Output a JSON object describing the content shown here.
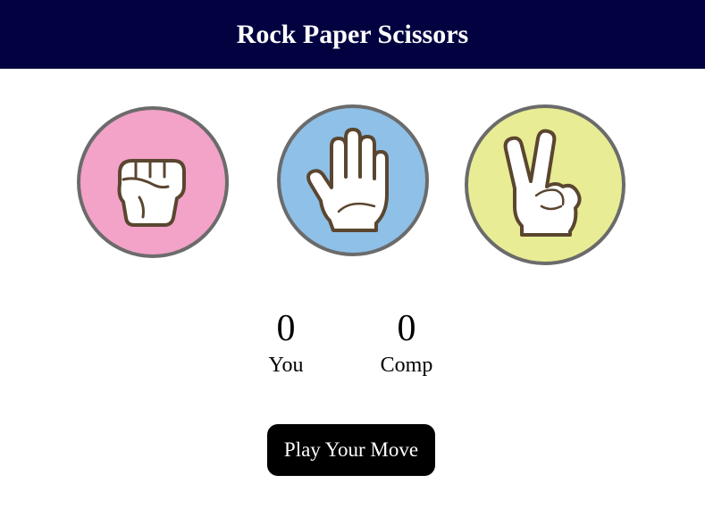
{
  "header": {
    "title": "Rock Paper Scissors"
  },
  "choices": [
    {
      "id": "rock",
      "icon": "fist-icon",
      "color": "#f3a2c8"
    },
    {
      "id": "paper",
      "icon": "open-hand-icon",
      "color": "#8ec0e8"
    },
    {
      "id": "scissors",
      "icon": "peace-sign-hand-icon",
      "color": "#e8ec94"
    }
  ],
  "scores": {
    "you": {
      "value": "0",
      "label": "You"
    },
    "comp": {
      "value": "0",
      "label": "Comp"
    }
  },
  "action": {
    "label": "Play Your Move"
  }
}
